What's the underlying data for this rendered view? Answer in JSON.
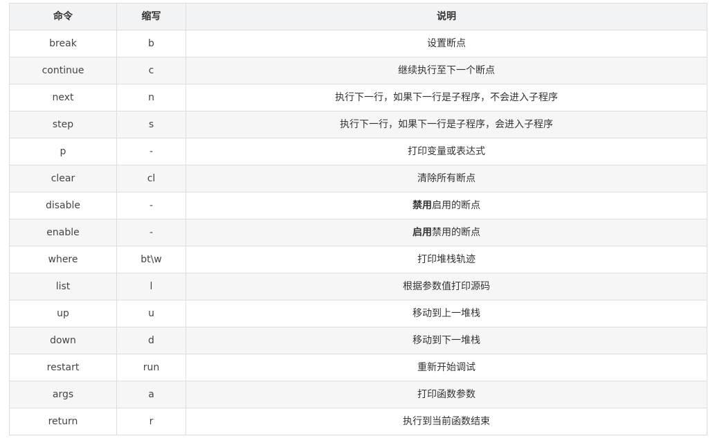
{
  "table": {
    "headers": {
      "command": "命令",
      "abbr": "缩写",
      "desc": "说明"
    },
    "rows": [
      {
        "command": "break",
        "abbr": "b",
        "desc_bold": "",
        "desc": "设置断点"
      },
      {
        "command": "continue",
        "abbr": "c",
        "desc_bold": "",
        "desc": "继续执行至下一个断点"
      },
      {
        "command": "next",
        "abbr": "n",
        "desc_bold": "",
        "desc": "执行下一行，如果下一行是子程序，不会进入子程序"
      },
      {
        "command": "step",
        "abbr": "s",
        "desc_bold": "",
        "desc": "执行下一行，如果下一行是子程序，会进入子程序"
      },
      {
        "command": "p",
        "abbr": "-",
        "desc_bold": "",
        "desc": "打印变量或表达式"
      },
      {
        "command": "clear",
        "abbr": "cl",
        "desc_bold": "",
        "desc": "清除所有断点"
      },
      {
        "command": "disable",
        "abbr": "-",
        "desc_bold": "禁用",
        "desc": "启用的断点"
      },
      {
        "command": "enable",
        "abbr": "-",
        "desc_bold": "启用",
        "desc": "禁用的断点"
      },
      {
        "command": "where",
        "abbr": "bt\\w",
        "desc_bold": "",
        "desc": "打印堆栈轨迹"
      },
      {
        "command": "list",
        "abbr": "l",
        "desc_bold": "",
        "desc": "根据参数值打印源码"
      },
      {
        "command": "up",
        "abbr": "u",
        "desc_bold": "",
        "desc": "移动到上一堆栈"
      },
      {
        "command": "down",
        "abbr": "d",
        "desc_bold": "",
        "desc": "移动到下一堆栈"
      },
      {
        "command": "restart",
        "abbr": "run",
        "desc_bold": "",
        "desc": "重新开始调试"
      },
      {
        "command": "args",
        "abbr": "a",
        "desc_bold": "",
        "desc": "打印函数参数"
      },
      {
        "command": "return",
        "abbr": "r",
        "desc_bold": "",
        "desc": "执行到当前函数结束"
      }
    ]
  }
}
